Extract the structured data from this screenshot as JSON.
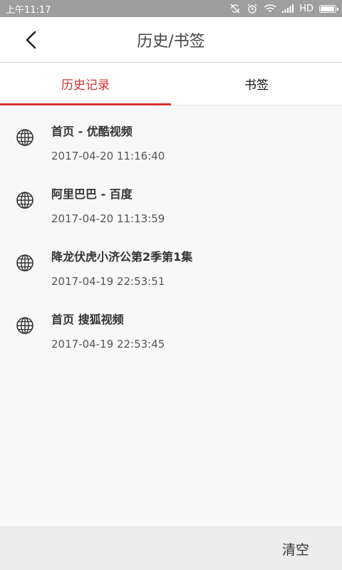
{
  "status_bar": {
    "time": "上午11:17",
    "network": "HD",
    "icons": [
      "no-sync-icon",
      "alarm-icon",
      "wifi-icon",
      "signal-icon",
      "battery-icon"
    ]
  },
  "header": {
    "title": "历史/书签",
    "back_icon": "chevron-left-icon"
  },
  "tabs": [
    {
      "label": "历史记录",
      "active": true
    },
    {
      "label": "书签",
      "active": false
    }
  ],
  "history": [
    {
      "title": "首页 - 优酷视频",
      "time": "2017-04-20 11:16:40",
      "icon": "globe-icon"
    },
    {
      "title": "阿里巴巴 - 百度",
      "time": "2017-04-20 11:13:59",
      "icon": "globe-icon"
    },
    {
      "title": "降龙伏虎小济公第2季第1集",
      "time": "2017-04-19 22:53:51",
      "icon": "globe-icon"
    },
    {
      "title": "首页 搜狐视频",
      "time": "2017-04-19 22:53:45",
      "icon": "globe-icon"
    }
  ],
  "footer": {
    "clear_label": "清空"
  },
  "colors": {
    "accent": "#d63232",
    "status_bar": "#9e9e9e",
    "background": "#f8f8f8"
  }
}
